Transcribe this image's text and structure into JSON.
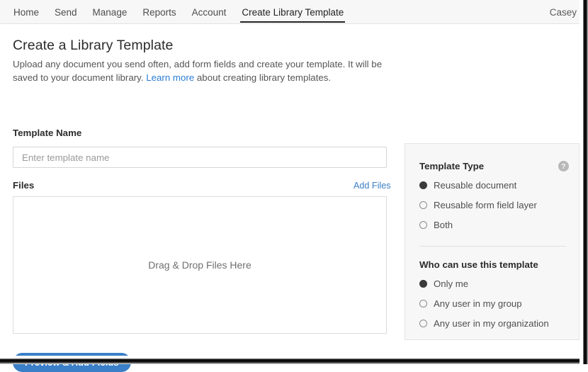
{
  "nav": {
    "items": [
      {
        "label": "Home",
        "active": false
      },
      {
        "label": "Send",
        "active": false
      },
      {
        "label": "Manage",
        "active": false
      },
      {
        "label": "Reports",
        "active": false
      },
      {
        "label": "Account",
        "active": false
      },
      {
        "label": "Create Library Template",
        "active": true
      }
    ],
    "user": "Casey"
  },
  "main": {
    "title": "Create a Library Template",
    "description_part1": "Upload any document you send often, add form fields and create your template. It will be saved to your document library. ",
    "description_link": "Learn more",
    "description_part2": " about creating library templates.",
    "template_name_label": "Template Name",
    "template_name_value": "",
    "template_name_placeholder": "Enter template name",
    "files_label": "Files",
    "add_files_label": "Add Files",
    "dropzone_text": "Drag & Drop Files Here",
    "primary_button_label": "Preview & Add Fields"
  },
  "options": {
    "template_type": {
      "title": "Template Type",
      "help_icon": "question-mark",
      "options": [
        {
          "label": "Reusable document",
          "selected": true
        },
        {
          "label": "Reusable form field layer",
          "selected": false
        },
        {
          "label": "Both",
          "selected": false
        }
      ]
    },
    "who_can_use": {
      "title": "Who can use this template",
      "options": [
        {
          "label": "Only me",
          "selected": true
        },
        {
          "label": "Any user in my group",
          "selected": false
        },
        {
          "label": "Any user in my organization",
          "selected": false
        }
      ]
    }
  },
  "colors": {
    "accent_blue": "#3a7fc8",
    "link_blue": "#2b7cd3",
    "panel_bg": "#f7f7f7",
    "nav_bg": "#f7f7f7"
  }
}
